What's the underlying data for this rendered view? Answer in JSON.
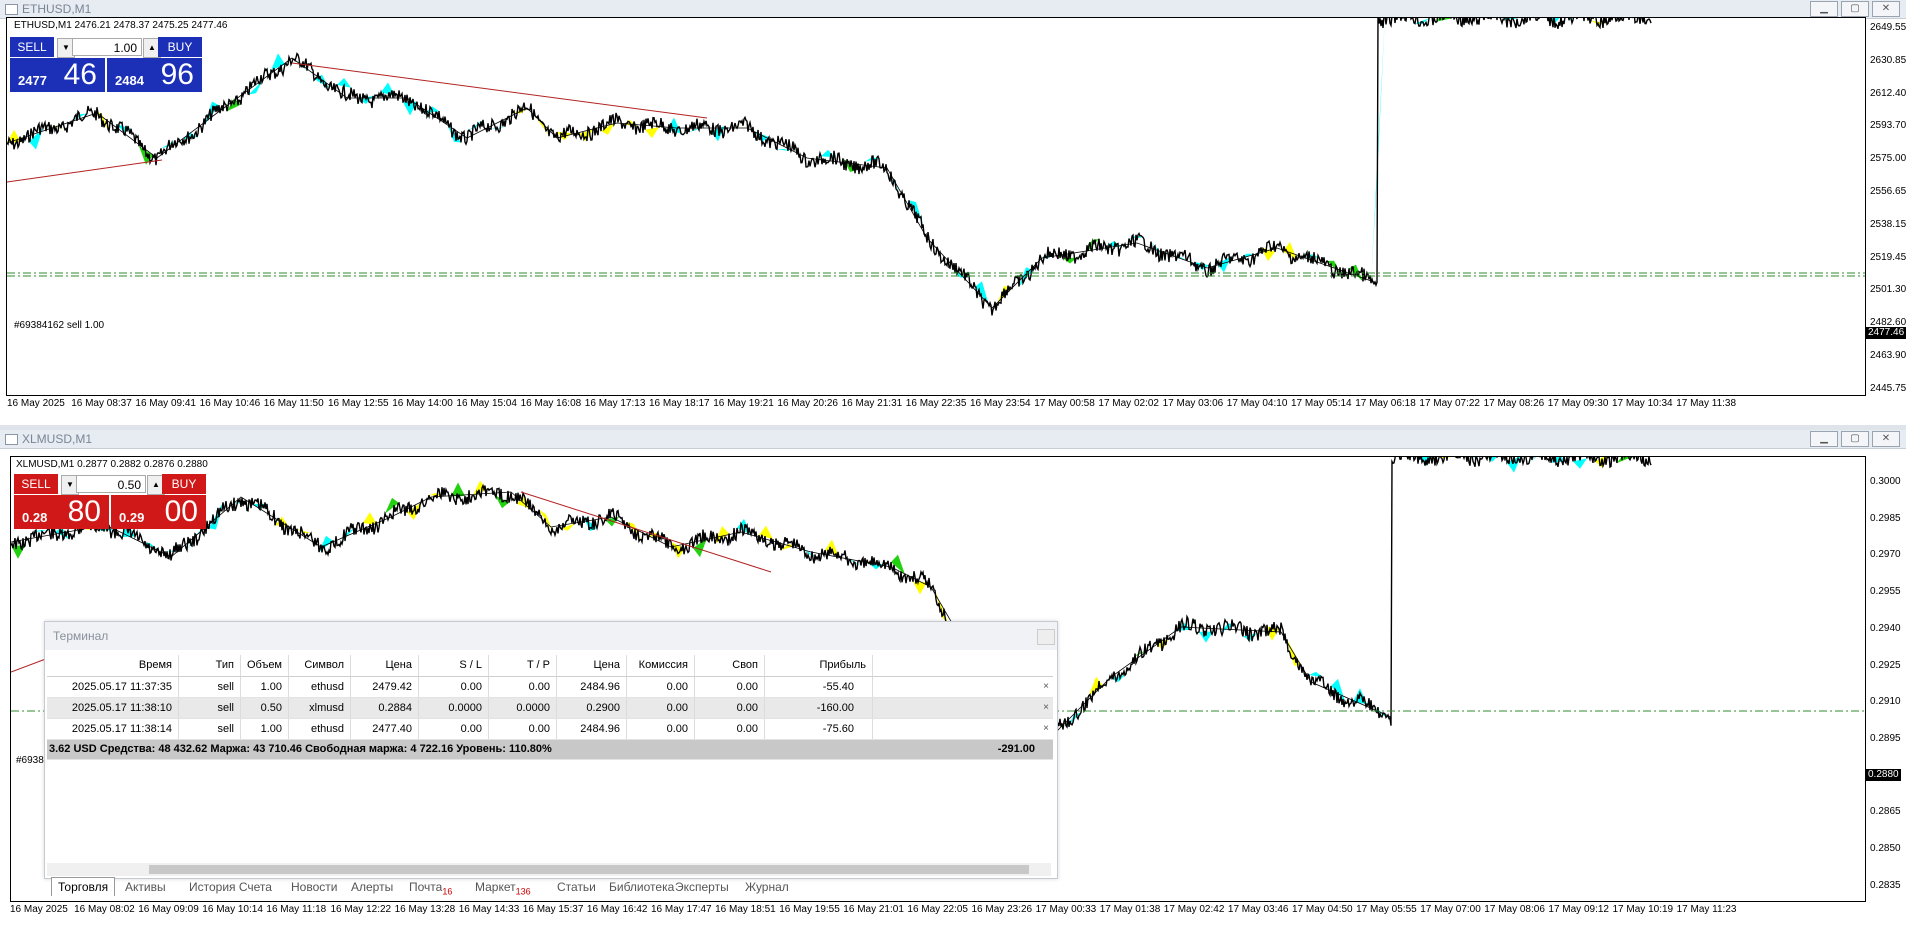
{
  "colors": {
    "sell_blue": "#1c2fb7",
    "buy_blue": "#1c2fb7",
    "sell_red": "#d01818",
    "buy_red": "#d01818",
    "fill_cyan": "#00ffff",
    "fill_yellow": "#ffff00",
    "fill_green": "#22d10f",
    "trend_red": "#b22222",
    "order_line_green": "#2e8b2e"
  },
  "chart1": {
    "window_title": "ETHUSD,M1",
    "symbol_info": "ETHUSD,M1  2476.21 2478.37 2475.25 2477.46",
    "panel": {
      "sell_label": "SELL",
      "buy_label": "BUY",
      "lot": "1.00",
      "sell_small": "2477",
      "sell_big": "46",
      "buy_small": "2484",
      "buy_big": "96"
    },
    "price_labels": [
      "2649.55",
      "2630.85",
      "2612.40",
      "2593.70",
      "2575.00",
      "2556.65",
      "2538.15",
      "2519.45",
      "2501.30",
      "2482.60",
      "2463.90",
      "2445.75"
    ],
    "current_price_tag": "2477.46",
    "order_label": "#69384162 sell 1.00",
    "time_labels": [
      "16 May 2025",
      "16 May 08:37",
      "16 May 09:41",
      "16 May 10:46",
      "16 May 11:50",
      "16 May 12:55",
      "16 May 14:00",
      "16 May 15:04",
      "16 May 16:08",
      "16 May 17:13",
      "16 May 18:17",
      "16 May 19:21",
      "16 May 20:26",
      "16 May 21:31",
      "16 May 22:35",
      "16 May 23:54",
      "17 May 00:58",
      "17 May 02:02",
      "17 May 03:06",
      "17 May 04:10",
      "17 May 05:14",
      "17 May 06:18",
      "17 May 07:22",
      "17 May 08:26",
      "17 May 09:30",
      "17 May 10:34",
      "17 May 11:38"
    ]
  },
  "chart2": {
    "window_title": "XLMUSD,M1",
    "symbol_info": "XLMUSD,M1  0.2877 0.2882 0.2876 0.2880",
    "panel": {
      "sell_label": "SELL",
      "buy_label": "BUY",
      "lot": "0.50",
      "sell_small": "0.28",
      "sell_big": "80",
      "buy_small": "0.29",
      "buy_big": "00"
    },
    "price_labels": [
      "0.3000",
      "0.2985",
      "0.2970",
      "0.2955",
      "0.2940",
      "0.2925",
      "0.2910",
      "0.2895",
      "0.2880",
      "0.2865",
      "0.2850",
      "0.2835"
    ],
    "current_price_tag": "0.2880",
    "order_label": "#6938",
    "time_labels": [
      "16 May 2025",
      "16 May 08:02",
      "16 May 09:09",
      "16 May 10:14",
      "16 May 11:18",
      "16 May 12:22",
      "16 May 13:28",
      "16 May 14:33",
      "16 May 15:37",
      "16 May 16:42",
      "16 May 17:47",
      "16 May 18:51",
      "16 May 19:55",
      "16 May 21:01",
      "16 May 22:05",
      "16 May 23:26",
      "17 May 00:33",
      "17 May 01:38",
      "17 May 02:42",
      "17 May 03:46",
      "17 May 04:50",
      "17 May 05:55",
      "17 May 07:00",
      "17 May 08:06",
      "17 May 09:12",
      "17 May 10:19",
      "17 May 11:23"
    ]
  },
  "terminal": {
    "title": "Терминал",
    "columns": [
      "Время",
      "Тип",
      "Объем",
      "Символ",
      "Цена",
      "S / L",
      "T / P",
      "Цена",
      "Комиссия",
      "Своп",
      "Прибыль"
    ],
    "rows": [
      {
        "time": "2025.05.17 11:37:35",
        "type": "sell",
        "volume": "1.00",
        "symbol": "ethusd",
        "price": "2479.42",
        "sl": "0.00",
        "tp": "0.00",
        "cur": "2484.96",
        "commission": "0.00",
        "swap": "0.00",
        "profit": "-55.40"
      },
      {
        "time": "2025.05.17 11:38:10",
        "type": "sell",
        "volume": "0.50",
        "symbol": "xlmusd",
        "price": "0.2884",
        "sl": "0.0000",
        "tp": "0.0000",
        "cur": "0.2900",
        "commission": "0.00",
        "swap": "0.00",
        "profit": "-160.00"
      },
      {
        "time": "2025.05.17 11:38:14",
        "type": "sell",
        "volume": "1.00",
        "symbol": "ethusd",
        "price": "2477.40",
        "sl": "0.00",
        "tp": "0.00",
        "cur": "2484.96",
        "commission": "0.00",
        "swap": "0.00",
        "profit": "-75.60"
      }
    ],
    "summary": "3.62 USD  Средства: 48 432.62  Маржа: 43 710.46  Свободная маржа: 4 722.16  Уровень: 110.80%",
    "summary_profit": "-291.00",
    "close_mark": "×",
    "tabs": [
      {
        "label": "Торговля",
        "badge": ""
      },
      {
        "label": "Активы",
        "badge": ""
      },
      {
        "label": "История Счета",
        "badge": ""
      },
      {
        "label": "Новости",
        "badge": ""
      },
      {
        "label": "Алерты",
        "badge": ""
      },
      {
        "label": "Почта",
        "badge": "16"
      },
      {
        "label": "Маркет",
        "badge": "136"
      },
      {
        "label": "Статьи",
        "badge": ""
      },
      {
        "label": "Библиотека",
        "badge": ""
      },
      {
        "label": "Эксперты",
        "badge": ""
      },
      {
        "label": "Журнал",
        "badge": ""
      }
    ]
  }
}
